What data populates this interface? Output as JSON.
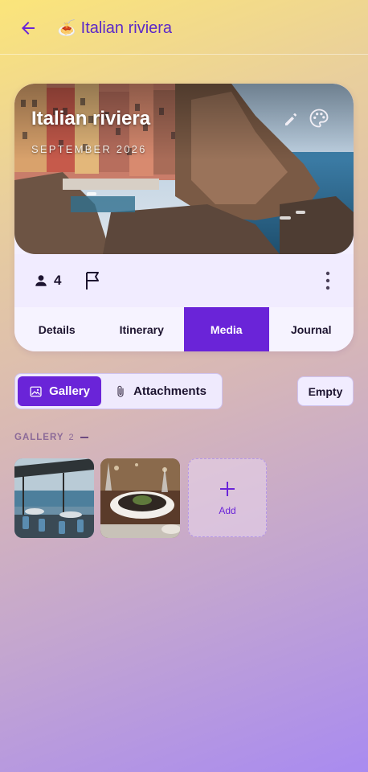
{
  "header": {
    "title": "Italian riviera",
    "emoji": "🍝"
  },
  "trip": {
    "name": "Italian riviera",
    "date": "SEPTEMBER 2026",
    "people_count": "4"
  },
  "tabs": [
    {
      "label": "Details",
      "active": false
    },
    {
      "label": "Itinerary",
      "active": false
    },
    {
      "label": "Media",
      "active": true
    },
    {
      "label": "Journal",
      "active": false
    }
  ],
  "media_toggle": {
    "gallery_label": "Gallery",
    "attachments_label": "Attachments",
    "selected": "Gallery"
  },
  "empty_button": {
    "label": "Empty"
  },
  "gallery": {
    "section_title": "GALLERY",
    "count": "2",
    "add_label": "Add",
    "images": [
      "seaside-terrace-restaurant",
      "plated-dinner-table"
    ]
  },
  "colors": {
    "accent": "#6a24d8",
    "title": "#5b28c9"
  }
}
